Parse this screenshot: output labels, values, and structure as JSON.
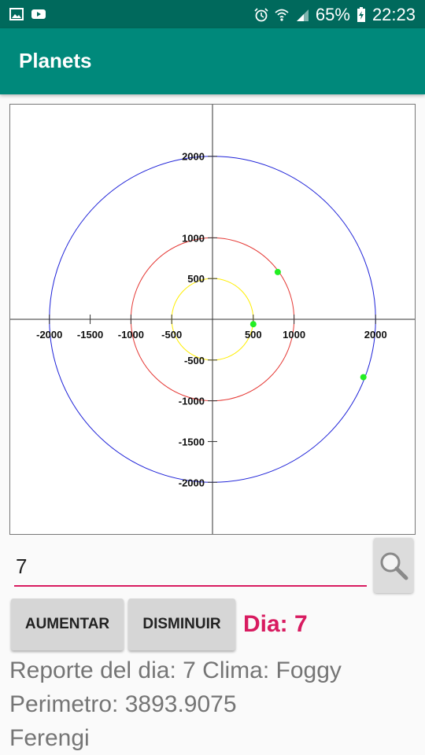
{
  "status_bar": {
    "battery": "65%",
    "time": "22:23",
    "icons": [
      "image-icon",
      "youtube-icon",
      "alarm-icon",
      "wifi-icon",
      "signal-icon",
      "battery-charging-icon"
    ]
  },
  "app_bar": {
    "title": "Planets"
  },
  "chart_data": {
    "type": "scatter",
    "x_ticks": [
      -2000,
      -1500,
      -1000,
      -500,
      500,
      1000,
      2000
    ],
    "y_ticks": [
      2000,
      1000,
      500,
      -500,
      -1000,
      -1500,
      -2000
    ],
    "x_tick_labels": [
      "-2000",
      "-1500",
      "-1000",
      "-500",
      "500",
      "1000",
      "2000"
    ],
    "y_tick_labels": [
      "2000",
      "1000",
      "500",
      "-500",
      "-1000",
      "-1500",
      "-2000"
    ],
    "xlim": [
      -2480,
      2480
    ],
    "ylim": [
      -2500,
      2500
    ],
    "orbits": [
      {
        "radius": 500,
        "color": "#ffee00"
      },
      {
        "radius": 1000,
        "color": "#e53935"
      },
      {
        "radius": 2000,
        "color": "#1e22d8"
      }
    ],
    "planets": [
      {
        "x": 500,
        "y": -60,
        "color": "#22ee22"
      },
      {
        "x": 800,
        "y": 580,
        "color": "#22ee22"
      },
      {
        "x": 1850,
        "y": -710,
        "color": "#22ee22"
      }
    ],
    "grid": false
  },
  "controls": {
    "day_input_value": "7",
    "increase_label": "AUMENTAR",
    "decrease_label": "DISMINUIR",
    "day_label": "Dia: 7"
  },
  "report": {
    "line1": "Reporte del dia: 7 Clima: Foggy",
    "line2": "Perimetro: 3893.9075",
    "line3": "Ferengi"
  }
}
